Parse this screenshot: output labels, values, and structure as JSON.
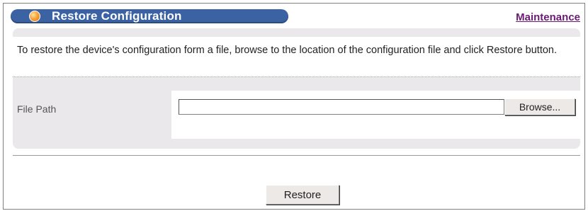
{
  "header": {
    "title": "Restore Configuration",
    "link_label": "Maintenance",
    "accent_color": "#3b62a3",
    "link_color": "#6b1a75"
  },
  "description": "To restore the device's configuration form a file, browse to the location of the configuration file and click Restore button.",
  "file_path": {
    "label": "File Path",
    "value": "",
    "browse_label": "Browse..."
  },
  "actions": {
    "restore_label": "Restore"
  }
}
